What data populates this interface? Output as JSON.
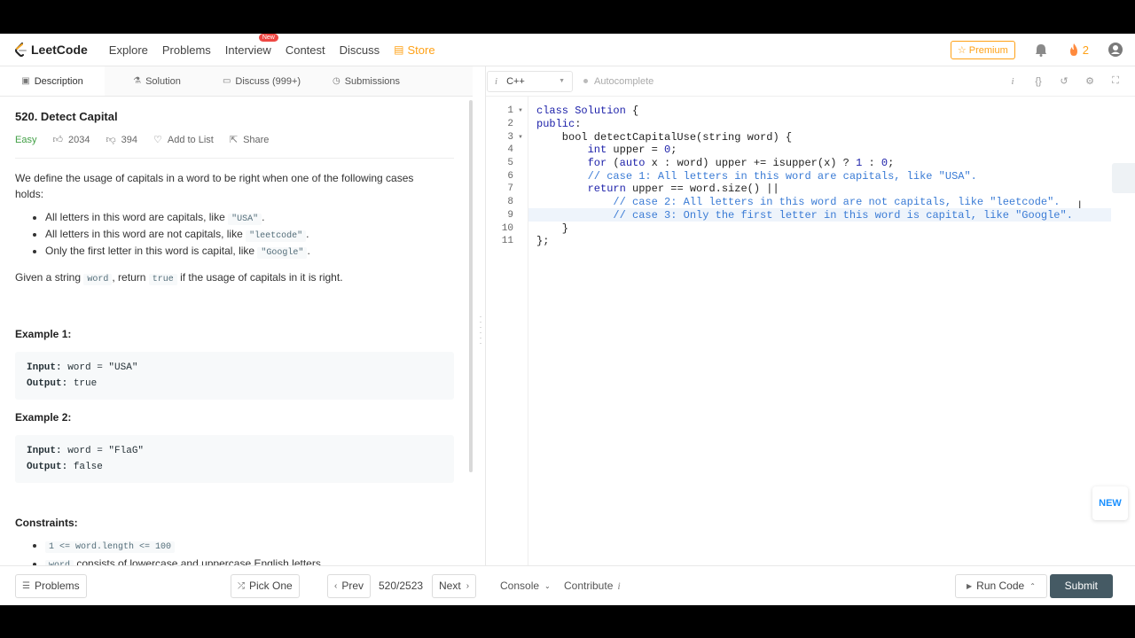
{
  "nav": {
    "logo_text": "LeetCode",
    "items": [
      "Explore",
      "Problems",
      "Interview",
      "Contest",
      "Discuss"
    ],
    "interview_badge": "New",
    "store": "Store",
    "premium": "Premium",
    "streak": "2"
  },
  "tabs": [
    {
      "label": "Description"
    },
    {
      "label": "Solution"
    },
    {
      "label": "Discuss (999+)"
    },
    {
      "label": "Submissions"
    }
  ],
  "problem": {
    "title": "520. Detect Capital",
    "difficulty": "Easy",
    "likes": "2034",
    "dislikes": "394",
    "add_to_list": "Add to List",
    "share": "Share",
    "intro": "We define the usage of capitals in a word to be right when one of the following cases holds:",
    "cases": [
      {
        "text": "All letters in this word are capitals, like ",
        "code": "\"USA\"",
        "tail": "."
      },
      {
        "text": "All letters in this word are not capitals, like ",
        "code": "\"leetcode\"",
        "tail": "."
      },
      {
        "text": "Only the first letter in this word is capital, like ",
        "code": "\"Google\"",
        "tail": "."
      }
    ],
    "given_a": "Given a string ",
    "given_code1": "word",
    "given_b": ", return ",
    "given_code2": "true",
    "given_c": " if the usage of capitals in it is right.",
    "example1_title": "Example 1:",
    "example1_input_label": "Input:",
    "example1_input": " word = \"USA\"",
    "example1_output_label": "Output:",
    "example1_output": " true",
    "example2_title": "Example 2:",
    "example2_input_label": "Input:",
    "example2_input": " word = \"FlaG\"",
    "example2_output_label": "Output:",
    "example2_output": " false",
    "constraints_title": "Constraints:",
    "constraint1": "1 <= word.length <= 100",
    "constraint2_code": "word",
    "constraint2_text": " consists of lowercase and uppercase English letters."
  },
  "editor": {
    "language": "C++",
    "autocomplete": "Autocomplete",
    "line_numbers": [
      "1",
      "2",
      "3",
      "4",
      "5",
      "6",
      "7",
      "8",
      "9",
      "10",
      "11"
    ],
    "new_label": "NEW"
  },
  "bottom": {
    "problems": "Problems",
    "pick_one": "Pick One",
    "prev": "Prev",
    "counter": "520/2523",
    "next": "Next",
    "console": "Console",
    "contribute": "Contribute",
    "run_code": "Run Code",
    "submit": "Submit"
  },
  "colors": {
    "brand_orange": "#ffa116",
    "easy_green": "#43a047",
    "submit_bg": "#455a64"
  }
}
